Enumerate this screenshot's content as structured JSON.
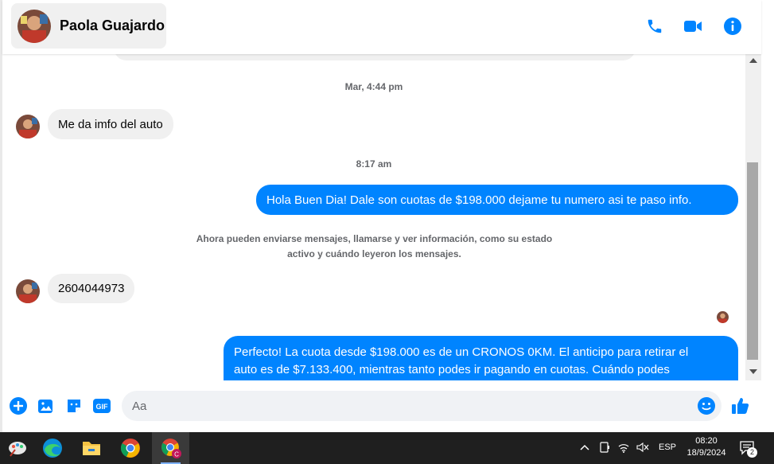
{
  "header": {
    "contact_name": "Paola Guajardo"
  },
  "messages": {
    "timestamp_1": "Mar, 4:44 pm",
    "incoming_1": "Me da imfo del auto",
    "timestamp_2": "8:17 am",
    "outgoing_1": "Hola Buen Dia! Dale son cuotas de $198.000 dejame tu numero asi te paso info.",
    "system_line_1": "Ahora pueden enviarse mensajes, llamarse y ver información, como su estado",
    "system_line_2": "activo y cuándo leyeron los mensajes.",
    "incoming_2": "2604044973",
    "outgoing_2_line_1": "Perfecto! La cuota desde $198.000 es de un CRONOS 0KM. El anticipo para retirar el",
    "outgoing_2_line_2": "auto es de $7.133.400, mientras tanto podes ir pagando en cuotas. Cuándo podes"
  },
  "composer": {
    "placeholder": "Aa"
  },
  "taskbar": {
    "language": "ESP",
    "time": "08:20",
    "date": "18/9/2024",
    "notification_count": "2"
  },
  "colors": {
    "accent": "#0084ff",
    "bubble_incoming": "#f0f0f0",
    "taskbar": "#1f1f1f"
  },
  "icons": [
    "phone-icon",
    "video-icon",
    "info-icon",
    "plus-icon",
    "image-icon",
    "sticker-icon",
    "gif-icon",
    "emoji-icon",
    "like-icon"
  ]
}
